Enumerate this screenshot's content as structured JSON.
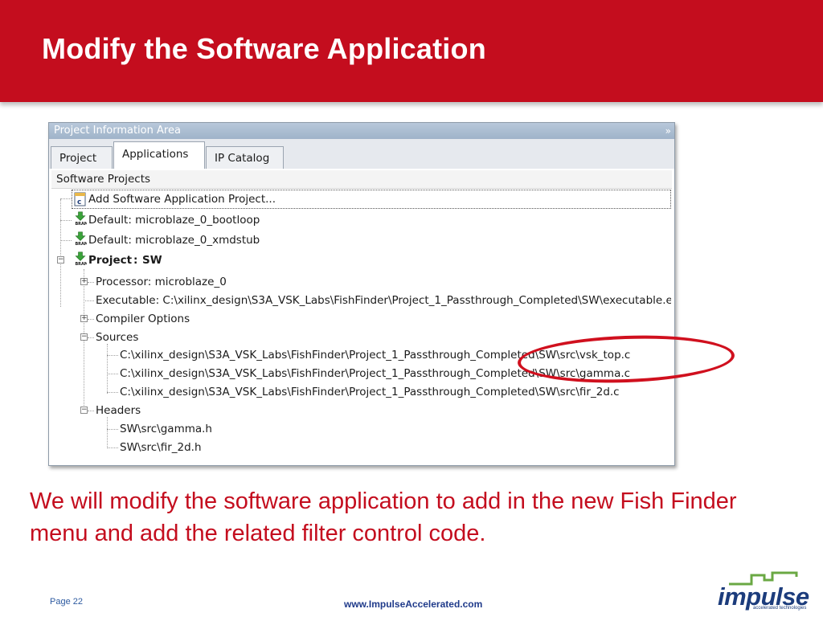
{
  "slide": {
    "title": "Modify the Software Application",
    "body": "We will modify the software application to add in the new Fish Finder menu and add the related filter control code.",
    "page": "Page 22",
    "url": "www.ImpulseAccelerated.com",
    "logo_text": "impulse",
    "logo_tagline": "accelerated technologies"
  },
  "panel": {
    "title": "Project Information Area",
    "close_glyph": "»",
    "tabs": [
      {
        "label": "Project",
        "active": false
      },
      {
        "label": "Applications",
        "active": true
      },
      {
        "label": "IP Catalog",
        "active": false
      }
    ],
    "tree_header": "Software Projects",
    "tree": {
      "add_project": "Add Software Application Project...",
      "bootloop": "Default: microblaze_0_bootloop",
      "xmdstub": "Default: microblaze_0_xmdstub",
      "project_prefix": "Project",
      "project_name": "SW",
      "processor": "Processor: microblaze_0",
      "executable": "Executable: C:\\xilinx_design\\S3A_VSK_Labs\\FishFinder\\Project_1_Passthrough_Completed\\SW\\executable.elf",
      "compiler_options": "Compiler Options",
      "sources": "Sources",
      "source_files": [
        "C:\\xilinx_design\\S3A_VSK_Labs\\FishFinder\\Project_1_Passthrough_Completed\\SW\\src\\vsk_top.c",
        "C:\\xilinx_design\\S3A_VSK_Labs\\FishFinder\\Project_1_Passthrough_Completed\\SW\\src\\gamma.c",
        "C:\\xilinx_design\\S3A_VSK_Labs\\FishFinder\\Project_1_Passthrough_Completed\\SW\\src\\fir_2d.c"
      ],
      "headers": "Headers",
      "header_files": [
        "SW\\src\\gamma.h",
        "SW\\src\\fir_2d.h"
      ]
    }
  },
  "colors": {
    "brand_red": "#c40d1e",
    "brand_blue": "#1c3c7c",
    "logo_green": "#6aa843"
  },
  "icons": {
    "add_project": "c-file-icon",
    "bram": "bram-download-icon",
    "expander": "tree-expander-icon"
  }
}
